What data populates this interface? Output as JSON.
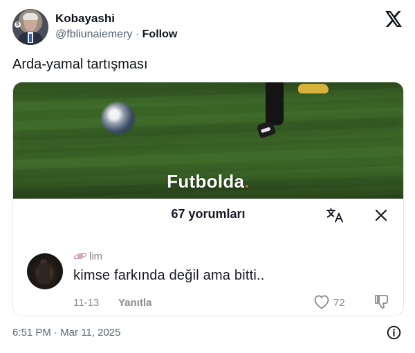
{
  "author": {
    "name": "Kobayashi",
    "handle": "@fbliunaiemery",
    "separator": "·",
    "follow_label": "Follow",
    "avatar_icon": "profile-photo"
  },
  "tweet": {
    "text": "Arda-yamal tartışması",
    "timestamp": "6:51 PM · Mar 11, 2025"
  },
  "media": {
    "caption_main": "Futbolda",
    "caption_accent": ".",
    "comments_header": "67 yorumları",
    "comment": {
      "username": "lim",
      "text": "kimse farkında değil ama bitti..",
      "date": "11-13",
      "reply_label": "Yanıtla",
      "likes": "72"
    }
  },
  "colors": {
    "text_primary": "#0f1419",
    "text_secondary": "#536471",
    "tiktok_gray": "#8a8b91",
    "pitch_green": "#3f6b2a"
  },
  "icons": [
    "x-logo-icon",
    "translate-icon",
    "close-icon",
    "heart-icon",
    "dislike-icon",
    "info-icon",
    "planet-icon"
  ]
}
